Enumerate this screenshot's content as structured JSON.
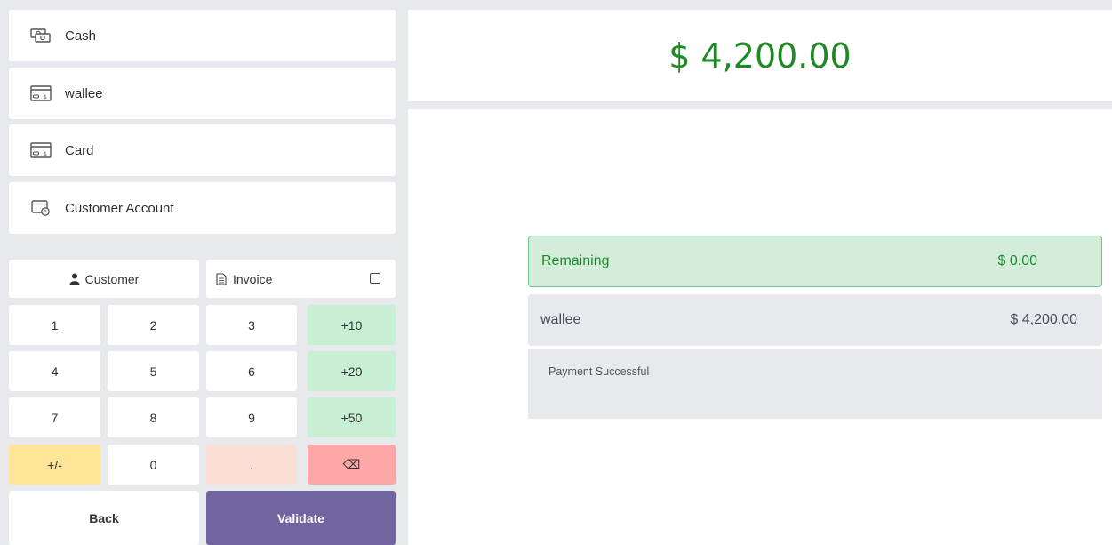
{
  "payment_methods": [
    {
      "label": "Cash",
      "icon": "cash-icon"
    },
    {
      "label": "wallee",
      "icon": "credit-card-icon"
    },
    {
      "label": "Card",
      "icon": "credit-card-icon"
    },
    {
      "label": "Customer Account",
      "icon": "customer-account-icon"
    }
  ],
  "actions": {
    "customer_label": "Customer",
    "invoice_label": "Invoice",
    "customer_icon": "user-icon",
    "invoice_icon": "document-icon",
    "invoice_checked": false
  },
  "keypad": {
    "k1": "1",
    "k2": "2",
    "k3": "3",
    "plus10": "+10",
    "k4": "4",
    "k5": "5",
    "k6": "6",
    "plus20": "+20",
    "k7": "7",
    "k8": "8",
    "k9": "9",
    "plus50": "+50",
    "plusminus": "+/-",
    "k0": "0",
    "dot": ".",
    "backspace": "⌫"
  },
  "footer": {
    "back_label": "Back",
    "validate_label": "Validate"
  },
  "summary": {
    "total": "$ 4,200.00",
    "remaining_label": "Remaining",
    "remaining_value": "$ 0.00",
    "line_method": "wallee",
    "line_amount": "$ 4,200.00",
    "status_message": "Payment Successful"
  },
  "colors": {
    "accent_green": "#1f8a25",
    "validate_purple": "#71639e",
    "increment_green": "#c8efd3",
    "backspace_red": "#fda8a8",
    "sign_yellow": "#ffe59a"
  }
}
